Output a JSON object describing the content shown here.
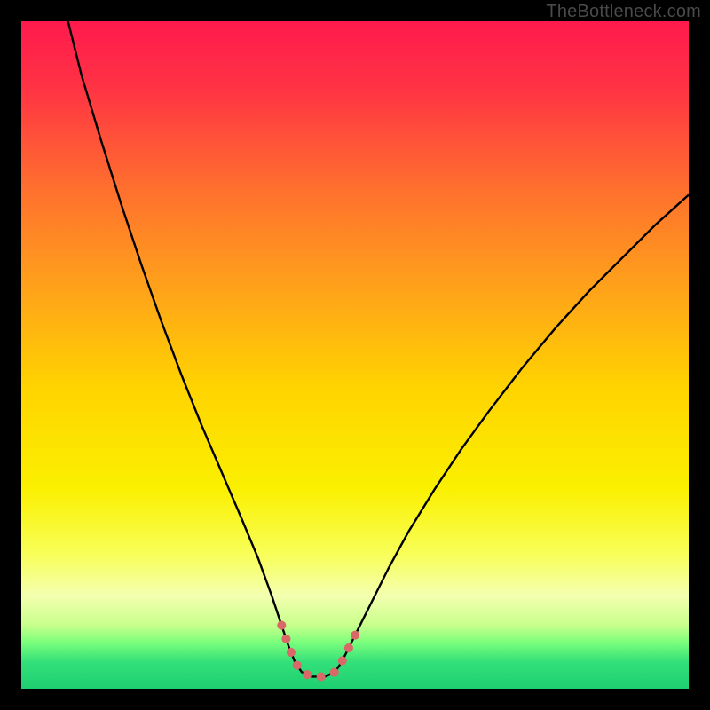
{
  "watermark": "TheBottleneck.com",
  "chart_data": {
    "type": "line",
    "title": "",
    "xlabel": "",
    "ylabel": "",
    "xlim": [
      0,
      100
    ],
    "ylim": [
      0,
      100
    ],
    "gradient_stops": [
      {
        "offset": 0.0,
        "color": "#ff1a4d"
      },
      {
        "offset": 0.1,
        "color": "#ff3344"
      },
      {
        "offset": 0.25,
        "color": "#ff6f2e"
      },
      {
        "offset": 0.4,
        "color": "#ffa21a"
      },
      {
        "offset": 0.55,
        "color": "#ffd400"
      },
      {
        "offset": 0.7,
        "color": "#faf000"
      },
      {
        "offset": 0.8,
        "color": "#f8ff5a"
      },
      {
        "offset": 0.86,
        "color": "#f4ffb0"
      },
      {
        "offset": 0.905,
        "color": "#c8ff8c"
      },
      {
        "offset": 0.93,
        "color": "#7cff7c"
      },
      {
        "offset": 0.96,
        "color": "#33e07a"
      },
      {
        "offset": 1.0,
        "color": "#1ecf6f"
      }
    ],
    "series": [
      {
        "name": "bottleneck-curve",
        "color": "#000000",
        "width": 2.4,
        "points": [
          {
            "x": 7.0,
            "y": 100.0
          },
          {
            "x": 9.0,
            "y": 92.0
          },
          {
            "x": 12.0,
            "y": 82.0
          },
          {
            "x": 15.0,
            "y": 72.5
          },
          {
            "x": 18.0,
            "y": 63.5
          },
          {
            "x": 21.0,
            "y": 55.0
          },
          {
            "x": 24.0,
            "y": 47.0
          },
          {
            "x": 27.0,
            "y": 39.5
          },
          {
            "x": 30.0,
            "y": 32.5
          },
          {
            "x": 33.0,
            "y": 25.5
          },
          {
            "x": 35.5,
            "y": 19.5
          },
          {
            "x": 37.5,
            "y": 14.0
          },
          {
            "x": 39.0,
            "y": 9.5
          },
          {
            "x": 40.0,
            "y": 6.5
          },
          {
            "x": 41.0,
            "y": 4.0
          },
          {
            "x": 42.0,
            "y": 2.5
          },
          {
            "x": 43.5,
            "y": 1.8
          },
          {
            "x": 45.5,
            "y": 1.8
          },
          {
            "x": 47.0,
            "y": 2.5
          },
          {
            "x": 48.0,
            "y": 4.0
          },
          {
            "x": 49.0,
            "y": 6.0
          },
          {
            "x": 50.5,
            "y": 9.0
          },
          {
            "x": 52.5,
            "y": 13.0
          },
          {
            "x": 55.0,
            "y": 18.0
          },
          {
            "x": 58.0,
            "y": 23.5
          },
          {
            "x": 62.0,
            "y": 30.0
          },
          {
            "x": 66.0,
            "y": 36.0
          },
          {
            "x": 70.0,
            "y": 41.5
          },
          {
            "x": 75.0,
            "y": 48.0
          },
          {
            "x": 80.0,
            "y": 54.0
          },
          {
            "x": 85.0,
            "y": 59.5
          },
          {
            "x": 90.0,
            "y": 64.5
          },
          {
            "x": 95.0,
            "y": 69.5
          },
          {
            "x": 100.0,
            "y": 74.0
          }
        ]
      },
      {
        "name": "highlight-segment",
        "color": "#d96868",
        "width": 10,
        "linecap": "round",
        "dash": "0.1 16",
        "points": [
          {
            "x": 39.0,
            "y": 9.5
          },
          {
            "x": 40.0,
            "y": 6.5
          },
          {
            "x": 41.0,
            "y": 4.0
          },
          {
            "x": 42.0,
            "y": 2.5
          },
          {
            "x": 43.5,
            "y": 1.8
          },
          {
            "x": 45.5,
            "y": 1.8
          },
          {
            "x": 47.0,
            "y": 2.5
          },
          {
            "x": 48.0,
            "y": 4.0
          },
          {
            "x": 49.0,
            "y": 6.0
          },
          {
            "x": 50.5,
            "y": 9.0
          }
        ]
      }
    ]
  }
}
